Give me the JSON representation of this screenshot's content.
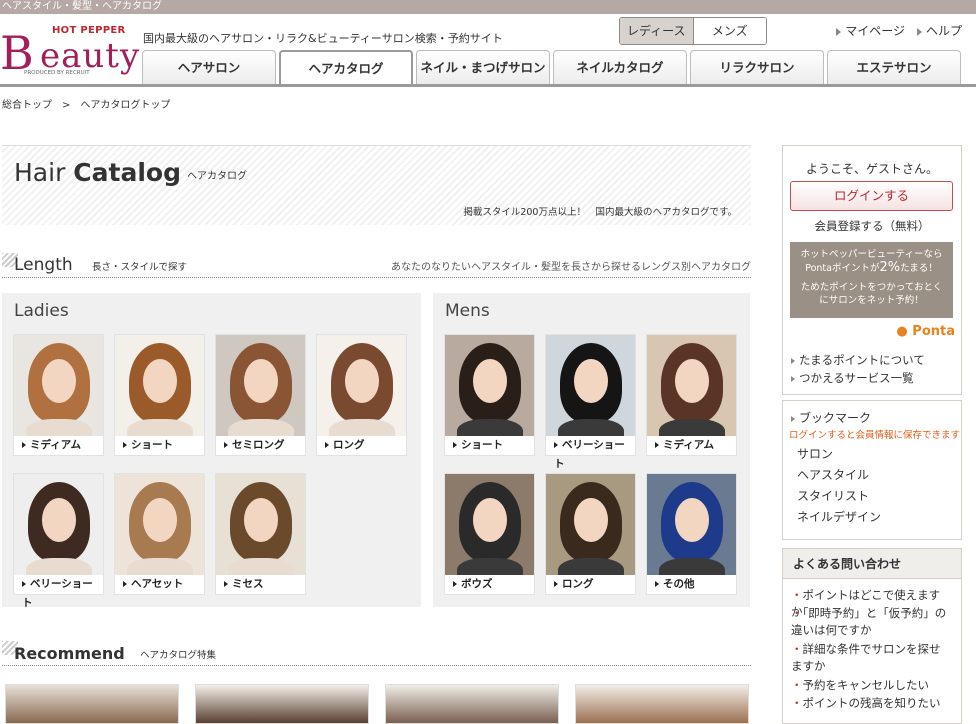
{
  "topbar": {
    "text": "ヘアスタイル・髪型・ヘアカタログ"
  },
  "logo": {
    "hot_pepper": "HOT PEPPER",
    "b": "B",
    "eauty": "eauty",
    "produced": "PRODUCED BY RECRUIT"
  },
  "tagline": "国内最大級のヘアサロン・リラク&ビューティーサロン検索・予約サイト",
  "gender": {
    "ladies": "レディース",
    "mens": "メンズ"
  },
  "toplinks": {
    "mypage": "マイページ",
    "help": "ヘルプ"
  },
  "tabs": [
    {
      "label": "ヘアサロン"
    },
    {
      "label": "ヘアカタログ",
      "active": true
    },
    {
      "label": "ネイル・まつげサロン"
    },
    {
      "label": "ネイルカタログ"
    },
    {
      "label": "リラクサロン"
    },
    {
      "label": "エステサロン"
    }
  ],
  "breadcrumb": {
    "home": "総合トップ",
    "sep": ">",
    "current": "ヘアカタログトップ"
  },
  "hero": {
    "title_a": "Hair",
    "title_b": "Catalog",
    "subtitle": "ヘアカタログ",
    "desc": "掲載スタイル200万点以上！　国内最大級のヘアカタログです。"
  },
  "length": {
    "title": "Length",
    "subtitle": "長さ・スタイルで探す",
    "note": "あなたのなりたいヘアスタイル・髪型を長さから探せるレングス別ヘアカタログ"
  },
  "ladies": {
    "title": "Ladies",
    "items": [
      {
        "label": "ミディアム",
        "hair": "#b07040",
        "bg": "#e9e6e2"
      },
      {
        "label": "ショート",
        "hair": "#9a5a2a",
        "bg": "#f3efe9"
      },
      {
        "label": "セミロング",
        "hair": "#8a5535",
        "bg": "#cfc8c0"
      },
      {
        "label": "ロング",
        "hair": "#7a4a30",
        "bg": "#f5f0ea"
      },
      {
        "label": "ベリーショート",
        "hair": "#3e2a20",
        "bg": "#eeeeee"
      },
      {
        "label": "ヘアセット",
        "hair": "#a87a50",
        "bg": "#ede3d8"
      },
      {
        "label": "ミセス",
        "hair": "#6a4a2a",
        "bg": "#e6e0d5"
      }
    ]
  },
  "mens": {
    "title": "Mens",
    "items": [
      {
        "label": "ショート",
        "hair": "#2a1e18",
        "bg": "#b9aaa0"
      },
      {
        "label": "ベリーショート",
        "hair": "#151515",
        "bg": "#cfd6dc"
      },
      {
        "label": "ミディアム",
        "hair": "#5a3525",
        "bg": "#d9c6b0"
      },
      {
        "label": "ボウズ",
        "hair": "#2a2a2a",
        "bg": "#8c7a6a"
      },
      {
        "label": "ロング",
        "hair": "#3a2a1e",
        "bg": "#a89a80"
      },
      {
        "label": "その他",
        "hair": "#1e3a8a",
        "bg": "#6a7a90"
      }
    ]
  },
  "recommend": {
    "title": "Recommend",
    "subtitle": "ヘアカタログ特集"
  },
  "sidebar": {
    "welcome": "ようこそ、ゲストさん。",
    "login": "ログインする",
    "register": "会員登録する（無料）",
    "ponta_l1": "ホットペッパービューティーなら",
    "ponta_l2a": "Pontaポイントが",
    "ponta_pct": "2%",
    "ponta_l2b": "たまる！",
    "ponta_l3": "ためたポイントをつかっておとく",
    "ponta_l4": "にサロンをネット予約！",
    "ponta_logo": "Ponta",
    "link1": "たまるポイントについて",
    "link2": "つかえるサービス一覧",
    "bookmark": "ブックマーク",
    "bookmark_note": "ログインすると会員情報に保存できます",
    "bm_items": [
      "サロン",
      "ヘアスタイル",
      "スタイリスト",
      "ネイルデザイン"
    ],
    "faq_title": "よくある問い合わせ",
    "faq": [
      "ポイントはどこで使えますか",
      "「即時予約」と「仮予約」の違いは何ですか",
      "詳細な条件でサロンを探せますか",
      "予約をキャンセルしたい",
      "ポイントの残高を知りたい"
    ]
  },
  "colors": {
    "brand": "#a31e5b",
    "accent_red": "#c0272d",
    "orange": "#e35c17"
  }
}
